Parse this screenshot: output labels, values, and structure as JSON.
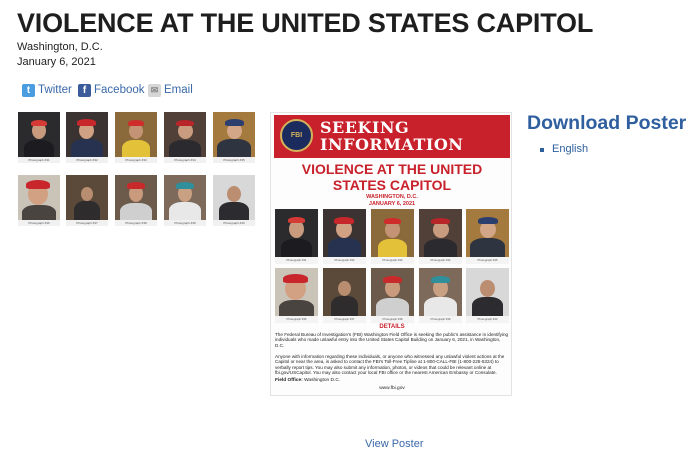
{
  "page": {
    "title": "VIOLENCE AT THE UNITED STATES CAPITOL",
    "location": "Washington, D.C.",
    "date": "January 6, 2021"
  },
  "share": {
    "twitter": "Twitter",
    "facebook": "Facebook",
    "email": "Email"
  },
  "gallery": [
    {
      "caption": "Photograph #31"
    },
    {
      "caption": "Photograph #32"
    },
    {
      "caption": "Photograph #33"
    },
    {
      "caption": "Photograph #34"
    },
    {
      "caption": "Photograph #35"
    },
    {
      "caption": "Photograph #36"
    },
    {
      "caption": "Photograph #37"
    },
    {
      "caption": "Photograph #38"
    },
    {
      "caption": "Photograph #39"
    },
    {
      "caption": "Photograph #40"
    }
  ],
  "poster": {
    "seeking": "SEEKING",
    "information": "INFORMATION",
    "seal_text": "FBI",
    "title_line1": "VIOLENCE AT THE UNITED",
    "title_line2": "STATES CAPITOL",
    "location": "WASHINGTON, D.C.",
    "date": "JANUARY 6, 2021",
    "details_heading": "DETAILS",
    "details_p1": "The Federal Bureau of Investigation's (FBI) Washington Field Office is seeking the public's assistance in identifying individuals who made unlawful entry into the United States Capitol Building on January 6, 2021, in Washington, D.C.",
    "details_p2": "Anyone with information regarding these individuals, or anyone who witnessed any unlawful violent actions at the Capitol or near the area, is asked to contact the FBI's Toll-Free Tipline at 1-800-CALL-FBI (1-800-225-5324) to verbally report tips. You may also submit any information, photos, or videos that could be relevant online at fbi.gov/USCapitol. You may also contact your local FBI office or the nearest American Embassy or Consulate.",
    "field_office_label": "Field Office:",
    "field_office_value": "Washington D.C.",
    "url": "www.fbi.gov"
  },
  "download": {
    "heading": "Download Poster",
    "language": "English"
  },
  "view_poster": "View Poster"
}
